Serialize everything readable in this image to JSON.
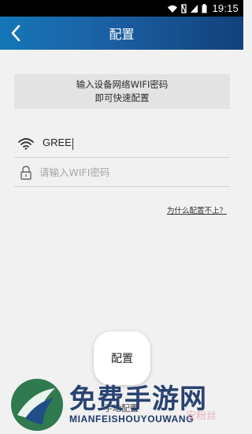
{
  "status_bar": {
    "time": "19:15"
  },
  "header": {
    "title": "配置",
    "back_icon": "chevron-left-icon"
  },
  "instruction": {
    "line1": "输入设备网络WIFI密码",
    "line2": "即可快速配置"
  },
  "ssid_field": {
    "icon": "wifi-icon",
    "value": "GREE"
  },
  "password_field": {
    "icon": "lock-icon",
    "placeholder": "请输入WIFI密码",
    "value": ""
  },
  "help_link": {
    "label": "为什么配置不上？"
  },
  "config_button": {
    "label": "配置"
  },
  "manual_link": {
    "label": "手动配置"
  },
  "watermark": {
    "title": "免费手游网",
    "subtitle": "MIANFEISHOUYOUWANG",
    "side_text": "安粉丝"
  },
  "colors": {
    "header_start": "#1577b7",
    "header_end": "#12417a",
    "background": "#f1f1f1",
    "instruction_bg": "#e3e3e3"
  }
}
